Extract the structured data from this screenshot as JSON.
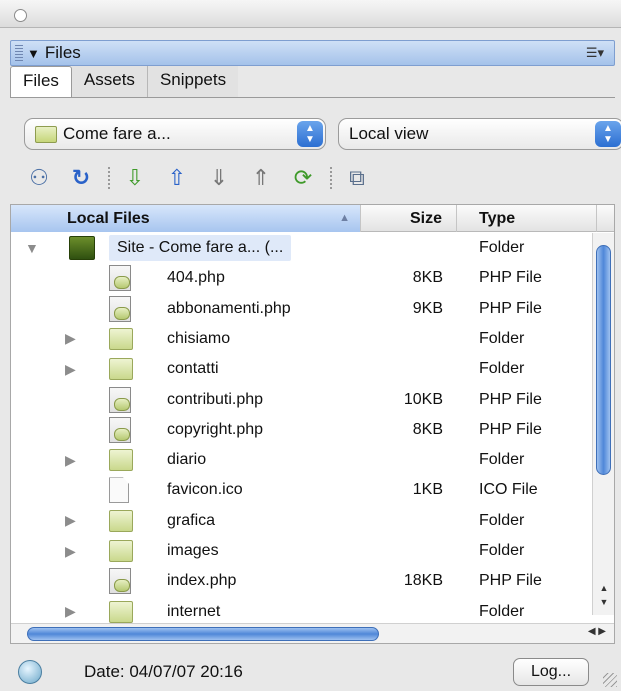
{
  "panel": {
    "title": "Files"
  },
  "tabs": [
    {
      "label": "Files",
      "active": true
    },
    {
      "label": "Assets",
      "active": false
    },
    {
      "label": "Snippets",
      "active": false
    }
  ],
  "site_select": {
    "value": "Come fare a..."
  },
  "view_select": {
    "value": "Local view"
  },
  "toolbar": [
    {
      "icon": "connect-icon"
    },
    {
      "icon": "refresh-icon"
    },
    {
      "icon": "get-files-icon"
    },
    {
      "icon": "put-files-icon"
    },
    {
      "icon": "check-out-icon"
    },
    {
      "icon": "check-in-icon"
    },
    {
      "icon": "synchronize-icon"
    },
    {
      "icon": "expand-panel-icon"
    }
  ],
  "table": {
    "columns": [
      "Local Files",
      "Size",
      "Type"
    ],
    "rows": [
      {
        "name": "Site - Come fare a... (...",
        "size": "",
        "type": "Folder",
        "kind": "site",
        "expanded": true
      },
      {
        "name": "404.php",
        "size": "8KB",
        "type": "PHP File",
        "kind": "php"
      },
      {
        "name": "abbonamenti.php",
        "size": "9KB",
        "type": "PHP File",
        "kind": "php"
      },
      {
        "name": "chisiamo",
        "size": "",
        "type": "Folder",
        "kind": "folder"
      },
      {
        "name": "contatti",
        "size": "",
        "type": "Folder",
        "kind": "folder"
      },
      {
        "name": "contributi.php",
        "size": "10KB",
        "type": "PHP File",
        "kind": "php"
      },
      {
        "name": "copyright.php",
        "size": "8KB",
        "type": "PHP File",
        "kind": "php"
      },
      {
        "name": "diario",
        "size": "",
        "type": "Folder",
        "kind": "folder"
      },
      {
        "name": "favicon.ico",
        "size": "1KB",
        "type": "ICO File",
        "kind": "file"
      },
      {
        "name": "grafica",
        "size": "",
        "type": "Folder",
        "kind": "folder"
      },
      {
        "name": "images",
        "size": "",
        "type": "Folder",
        "kind": "folder"
      },
      {
        "name": "index.php",
        "size": "18KB",
        "type": "PHP File",
        "kind": "php"
      },
      {
        "name": "internet",
        "size": "",
        "type": "Folder",
        "kind": "folder"
      }
    ]
  },
  "status": {
    "text": "Date: 04/07/07 20:16",
    "log_label": "Log..."
  }
}
